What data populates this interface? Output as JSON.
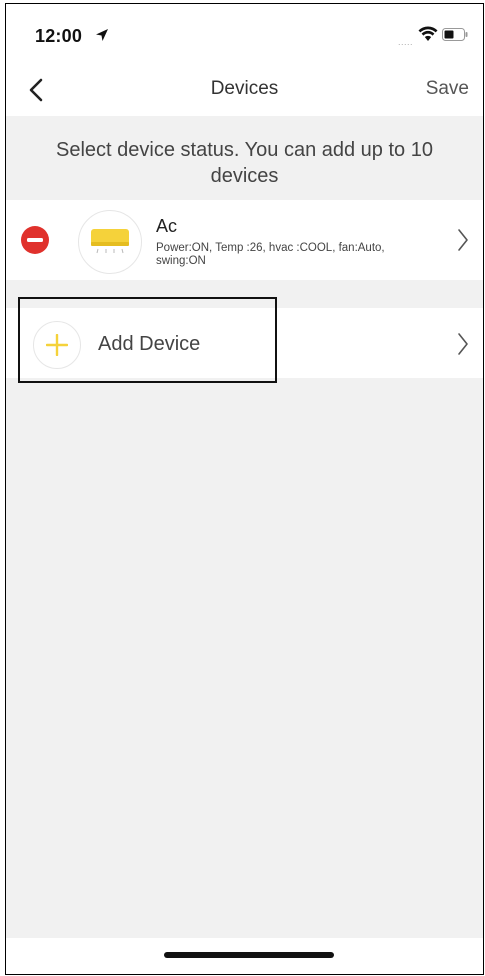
{
  "status_bar": {
    "time": "12:00",
    "signal_dots": "....."
  },
  "nav": {
    "title": "Devices",
    "save_label": "Save"
  },
  "hint": "Select device status. You can add up to 10 devices",
  "devices": [
    {
      "name": "Ac",
      "status": "Power:ON, Temp :26, hvac :COOL, fan:Auto, swing:ON",
      "icon": "air-conditioner-icon"
    }
  ],
  "add_device": {
    "label": "Add Device",
    "icon": "plus-icon"
  },
  "colors": {
    "remove_red": "#e0312c",
    "accent_yellow": "#f5d23a",
    "background": "#f1f1f1"
  }
}
